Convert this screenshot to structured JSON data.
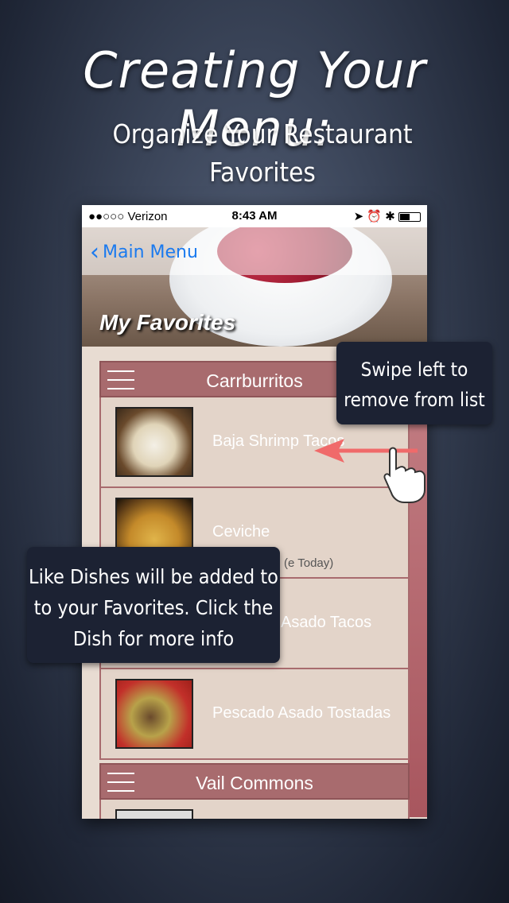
{
  "headline": "Creating Your Menu:",
  "subhead": "Organize Your Restaurant Favorites",
  "status_bar": {
    "carrier": "●●○○○ Verizon",
    "time": "8:43 AM",
    "right_icons": "➤ ⏰ ✱"
  },
  "nav": {
    "back_label": "Main Menu"
  },
  "hero_title": "My Favorites",
  "sections": [
    {
      "title": "Carrburritos"
    },
    {
      "title": "Vail Commons"
    }
  ],
  "rows": [
    {
      "name": "Baja Shrimp Tacos"
    },
    {
      "name": "Ceviche",
      "note": "(e Today)"
    },
    {
      "name": "Asado Tacos"
    },
    {
      "name": "Pescado Asado Tostadas"
    }
  ],
  "callouts": {
    "swipe": "Swipe left to remove from list",
    "like": "Like Dishes will be added to to your Favorites. Click the Dish for more info"
  },
  "colors": {
    "accent": "#1a7aef",
    "section": "#a86b6e",
    "callout": "#1c2233"
  }
}
